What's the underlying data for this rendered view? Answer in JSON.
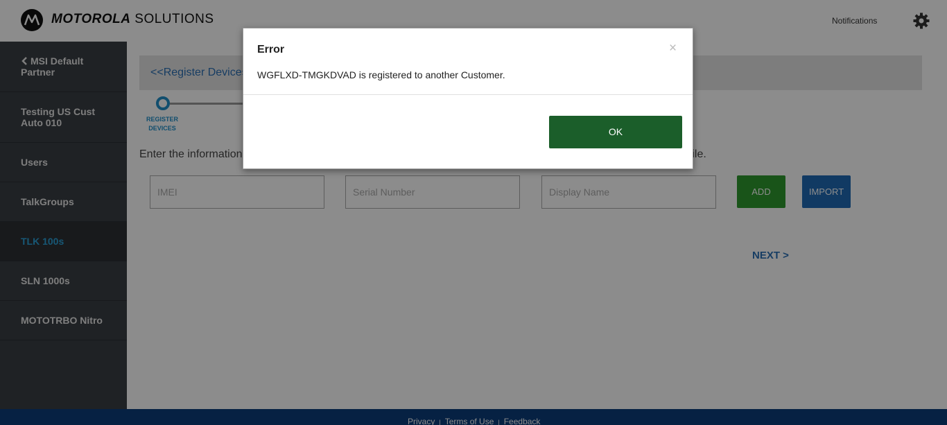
{
  "header": {
    "brand_bold": "MOTOROLA",
    "brand_light": "SOLUTIONS",
    "notifications_label": "Notifications",
    "settings_icon": "gear-icon"
  },
  "sidebar": {
    "back_icon": "chevron-left-icon",
    "items": [
      {
        "label": "MSI Default Partner"
      },
      {
        "label": "Testing US Cust Auto 010"
      },
      {
        "label": "Users"
      },
      {
        "label": "TalkGroups"
      },
      {
        "label": "TLK 100s",
        "active": true
      },
      {
        "label": "SLN 1000s"
      },
      {
        "label": "MOTOTRBO Nitro"
      }
    ]
  },
  "main": {
    "breadcrumb": "<<Register Devices",
    "step_label": "REGISTER DEVICES",
    "info_text_start": "Enter the information",
    "info_text_end": "/ file.",
    "imei_placeholder": "IMEI",
    "serial_placeholder": "Serial Number",
    "display_name_placeholder": "Display Name",
    "add_label": "ADD",
    "import_label": "IMPORT",
    "next_label": "NEXT >"
  },
  "footer": {
    "privacy": "Privacy",
    "terms": "Terms of Use",
    "feedback": "Feedback"
  },
  "dialog": {
    "title": "Error",
    "close": "×",
    "message": "WGFLXD-TMGKDVAD is registered to another Customer.",
    "ok_label": "OK"
  },
  "colors": {
    "sidebar_bg": "#3a3f44",
    "active_text": "#2aa1d8",
    "link_blue": "#2a6fb5",
    "add_green": "#2e9a2e",
    "import_blue": "#1f6ab5",
    "ok_green": "#1b5e2a",
    "footer_blue": "#0b3d7a"
  }
}
